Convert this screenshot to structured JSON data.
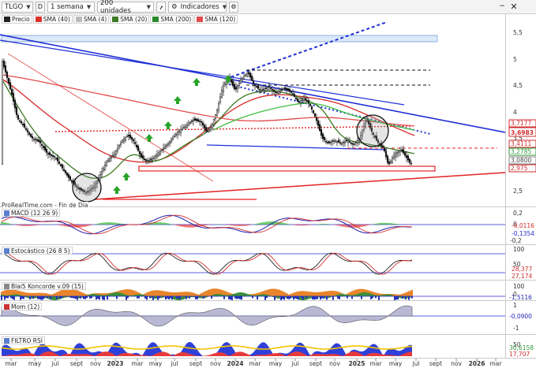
{
  "toolbar": {
    "symbol": "TLGO",
    "type_badge": "D",
    "period": "1 semana",
    "units": "200 unidades",
    "indicators": "Indicadores",
    "minimize": "−",
    "close": "✕"
  },
  "legend": {
    "items": [
      {
        "label": "Precio",
        "color": "#222222"
      },
      {
        "label": "SMA (40)",
        "color": "#e0302b"
      },
      {
        "label": "SMA (4)",
        "color": "#bbbbbb"
      },
      {
        "label": "SMA (20)",
        "color": "#3d7b23"
      },
      {
        "label": "SMA (200)",
        "color": "#2c8a2c"
      },
      {
        "label": "SMA (120)",
        "color": "#e24b4b"
      }
    ]
  },
  "source_note": "ProRealTime.com - Fin de Día",
  "price_axis": {
    "ticks": [
      "5,5",
      "5",
      "4,5",
      "4",
      "3,5",
      "3",
      "2,5"
    ],
    "tags": [
      {
        "text": "3,7177",
        "color": "#d12d2d"
      },
      {
        "text": "3,6983",
        "color": "#d12d2d"
      },
      {
        "text": "3,4111",
        "color": "#d12d2d"
      },
      {
        "text": "3,2785",
        "color": "#2f9a3a"
      },
      {
        "text": "3,0800",
        "color": "#444444"
      },
      {
        "text": "2,975",
        "color": "#d12d2d"
      }
    ]
  },
  "panes": {
    "macd": {
      "title": "MACD (12 26 9)",
      "ticks": [
        "0,2",
        "0",
        "-0,2"
      ],
      "tags": [
        "-0,0116",
        "-0,1354"
      ]
    },
    "stoch": {
      "title": "Estocástico (26 8 5)",
      "ticks": [
        "100",
        "50"
      ],
      "tags": [
        "28,377",
        "27,174"
      ]
    },
    "blai5": {
      "title": "Blai5 Koncorde v.09 (15)",
      "ticks": [
        "100",
        "0"
      ],
      "tags": [
        "-1,5116"
      ]
    },
    "mom": {
      "title": "Mom (12)",
      "ticks": [
        "1",
        "-0,0900",
        "-1"
      ],
      "tags": []
    },
    "rsi": {
      "title": "FILTRO RSI",
      "ticks": [
        "50"
      ],
      "tags": [
        "30,6158",
        "17,707"
      ]
    }
  },
  "time_axis": [
    "mar",
    "may",
    "jul",
    "sept",
    "nov",
    "2023",
    "mar",
    "may",
    "jul",
    "sept",
    "nov",
    "2024",
    "mar",
    "may",
    "jul",
    "sept",
    "nov",
    "2025",
    "mar",
    "may",
    "jul",
    "sept",
    "nov",
    "2026",
    "mar"
  ],
  "colors": {
    "blue_trend": "#1f2fd6",
    "red_trend": "#e42323",
    "sma40": "#e0302b",
    "sma20": "#3d7b23",
    "sma200": "#2c8a2c",
    "sma120": "#e24b4b",
    "price": "#111111"
  }
}
